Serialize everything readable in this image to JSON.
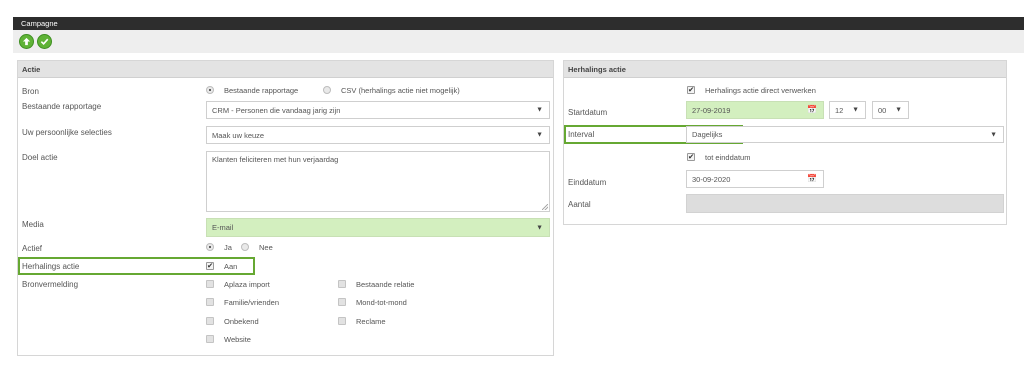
{
  "window": {
    "title": "Campagne"
  },
  "toolbar": {
    "up_icon": "arrow-up-icon",
    "confirm_icon": "checkmark-icon",
    "accent": "#5fb336"
  },
  "actie": {
    "header": "Actie",
    "bron": {
      "label": "Bron",
      "options": [
        "Bestaande rapportage",
        "CSV (herhalings actie niet mogelijk)"
      ],
      "selected": "Bestaande rapportage"
    },
    "bestaande_rapportage": {
      "label": "Bestaande rapportage",
      "value": "CRM - Personen die vandaag jarig zijn"
    },
    "selecties": {
      "label": "Uw persoonlijke selecties",
      "value": "Maak uw keuze"
    },
    "doel": {
      "label": "Doel actie",
      "value": "Klanten feliciteren met hun verjaardag"
    },
    "media": {
      "label": "Media",
      "value": "E-mail"
    },
    "actief": {
      "label": "Actief",
      "options": [
        "Ja",
        "Nee"
      ],
      "selected": "Ja"
    },
    "herhalings": {
      "label": "Herhalings actie",
      "checkbox_label": "Aan",
      "checked": true
    },
    "bronvermelding": {
      "label": "Bronvermelding",
      "options": [
        "Aplaza import",
        "Bestaande relatie",
        "Familie/vrienden",
        "Mond-tot-mond",
        "Onbekend",
        "Reclame",
        "Website"
      ]
    }
  },
  "herhaling": {
    "header": "Herhalings actie",
    "direct": {
      "label": "Herhalings actie direct verwerken",
      "checked": true
    },
    "startdatum": {
      "label": "Startdatum",
      "value": "27-09-2019",
      "hour": "12",
      "minute": "00"
    },
    "interval": {
      "label": "Interval",
      "value": "Dagelijks"
    },
    "tot": {
      "label": "tot einddatum",
      "checked": true
    },
    "einddatum": {
      "label": "Einddatum",
      "value": "30-09-2020"
    },
    "aantal": {
      "label": "Aantal",
      "value": ""
    }
  },
  "colors": {
    "highlight": "#66a832",
    "field_green": "#d3efbf"
  }
}
